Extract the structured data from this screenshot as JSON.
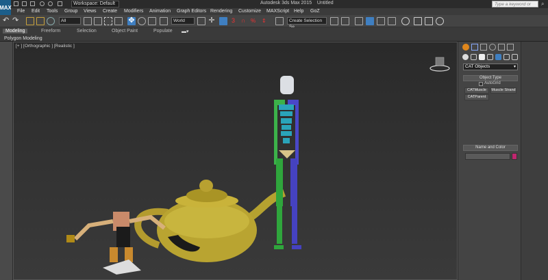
{
  "titlebar": {
    "logo_text": "MAX",
    "workspace": "Workspace: Default",
    "app_title": "Autodesk 3ds Max  2015",
    "file_title": "Untitled",
    "search_placeholder": "Type a keyword or phrase"
  },
  "menu": [
    "File",
    "Edit",
    "Tools",
    "Group",
    "Views",
    "Create",
    "Modifiers",
    "Animation",
    "Graph Editors",
    "Rendering",
    "Customize",
    "MAXScript",
    "Help",
    "GoZ"
  ],
  "toolbar": {
    "selection_filter": "All",
    "coord_system": "World",
    "selection_set": "Create Selection Se",
    "icons": [
      "undo-icon",
      "redo-icon",
      "link-icon",
      "unlink-icon",
      "bind-space-warp-icon",
      "select-object-icon",
      "select-by-name-icon",
      "rect-select-icon",
      "window-crossing-icon",
      "select-move-icon",
      "select-rotate-icon",
      "select-scale-icon",
      "pivot-icon",
      "select-manipulate-icon",
      "keyboard-shortcut-icon",
      "snaps-toggle-icon",
      "angle-snap-icon",
      "percent-snap-icon",
      "spinner-snap-icon",
      "edit-named-sel-icon",
      "mirror-icon",
      "align-icon",
      "layer-explorer-icon",
      "toggle-ribbon-icon",
      "curve-editor-icon",
      "schematic-view-icon",
      "material-editor-icon",
      "render-setup-icon",
      "rendered-frame-icon",
      "render-production-icon"
    ]
  },
  "ribbon": {
    "tabs": [
      "Modeling",
      "Freeform",
      "Selection",
      "Object Paint",
      "Populate"
    ],
    "active_tab": "Modeling",
    "panel_label": "Polygon Modeling"
  },
  "viewport": {
    "label": "[+ ] [Orthographic ] [Realistic ]"
  },
  "command_panel": {
    "tabs": [
      "create-tab-icon",
      "modify-tab-icon",
      "hierarchy-tab-icon",
      "motion-tab-icon",
      "display-tab-icon",
      "utilities-tab-icon"
    ],
    "category": "CAT Objects",
    "object_type_title": "Object Type",
    "autogrid": "AutoGrid",
    "buttons": [
      "CATMuscle",
      "Muscle Strand",
      "CATParent"
    ],
    "name_color_title": "Name and Color",
    "object_color": "#c0266f"
  }
}
